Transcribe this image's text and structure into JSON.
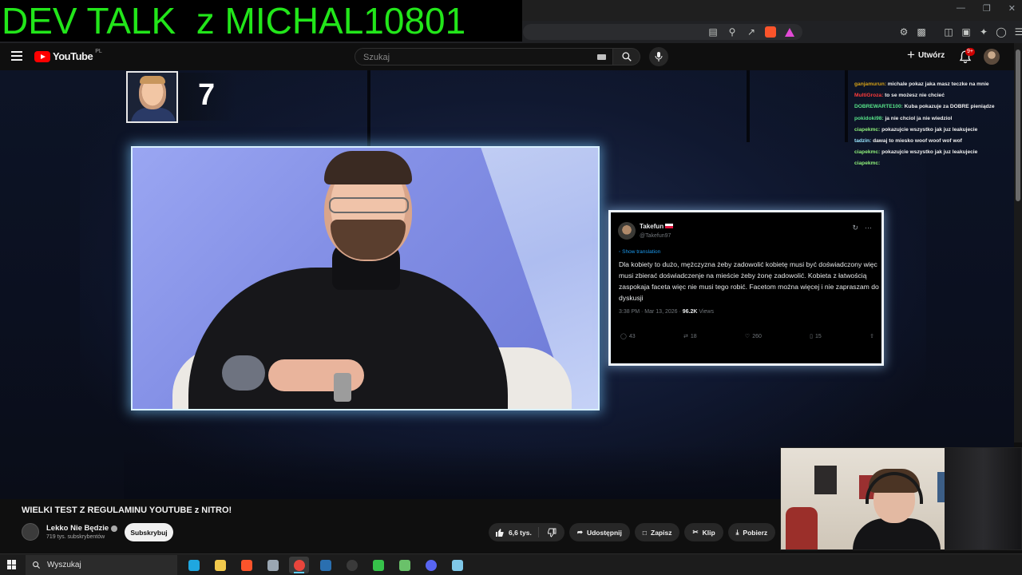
{
  "overlay": {
    "title": "DEV TALK  z MICHAL10801"
  },
  "header": {
    "logo_text": "YouTube",
    "logo_country": "PL",
    "search_placeholder": "Szukaj",
    "create_label": "Utwórz",
    "notifications_badge": "9+"
  },
  "video": {
    "rank_number": "7",
    "tweet": {
      "name": "Takefun",
      "handle": "@Takefun97",
      "translate_label": "Show translation",
      "text": "Dla kobiety to dużo, mężczyzna żeby zadowolić kobietę musi być doświadczony więc musi zbierać doświadczenje na mieście żeby żonę zadowolić. Kobieta z łatwością zaspokaja faceta więc nie musi tego robić.  Facetom można więcej i nie zapraszam do dyskusji",
      "time": "3:38 PM · Mar 13, 2026 · ",
      "views_count": "96.2K",
      "views_label": " Views",
      "replies": "43",
      "reposts": "18",
      "likes": "260",
      "bookmarks": "15"
    },
    "chat": [
      {
        "user": "ganjamurun:",
        "message": " michale pokaz jaka masz teczke na mnie",
        "color": "#d4a017"
      },
      {
        "user": "MultiGroza:",
        "message": " to se możesz nie chcieć",
        "color": "#ff3b3b"
      },
      {
        "user": "DOBREWARTE100:",
        "message": " Kuba pokazuje za DOBRE pieniądze",
        "color": "#57e389"
      },
      {
        "user": "pokidoki98:",
        "message": " ja nie chciol ja nie wiedziol",
        "color": "#57e389"
      },
      {
        "user": "ciapekmc:",
        "message": " pokazujcie wszystko jak juz leakujecie",
        "color": "#8ff07a"
      },
      {
        "user": "tadzin:",
        "message": " dawaj to miesko woof woof wof wof",
        "color": "#9be7ff"
      },
      {
        "user": "ciapekmc:",
        "message": " pokazujcie wszystko jak juz leakujecie",
        "color": "#8ff07a"
      },
      {
        "user": "ciapekmc:",
        "message": "",
        "color": "#8ff07a"
      }
    ]
  },
  "info": {
    "title": "WIELKI TEST Z REGULAMINU YOUTUBE z NITRO!",
    "channel_name": "Lekko Nie Będzie",
    "subscribers": "719 tys. subskrybentów",
    "subscribe_label": "Subskrybuj",
    "likes": "6,6 tys.",
    "share_label": "Udostępnij",
    "save_label": "Zapisz",
    "clip_label": "Klip",
    "download_label": "Pobierz"
  },
  "taskbar": {
    "search_label": "Wyszukaj",
    "apps": [
      {
        "name": "edge",
        "color": "#1fa7e0"
      },
      {
        "name": "explorer",
        "color": "#f2c94c"
      },
      {
        "name": "brave",
        "color": "#fb542b"
      },
      {
        "name": "virtualbox",
        "color": "#9aa6b2"
      },
      {
        "name": "chrome",
        "color": "#e8453c"
      },
      {
        "name": "steam",
        "color": "#2a6fb0"
      },
      {
        "name": "obs",
        "color": "#3a3a3a"
      },
      {
        "name": "app-green",
        "color": "#36c24a"
      },
      {
        "name": "app-multi",
        "color": "#6ac16a"
      },
      {
        "name": "discord",
        "color": "#5865f2"
      },
      {
        "name": "notepad",
        "color": "#7fc7e8"
      }
    ]
  },
  "colors": {
    "overlay_text": "#22e61a",
    "accent_red": "#ff0000",
    "tweet_link": "#1d9bf0"
  }
}
